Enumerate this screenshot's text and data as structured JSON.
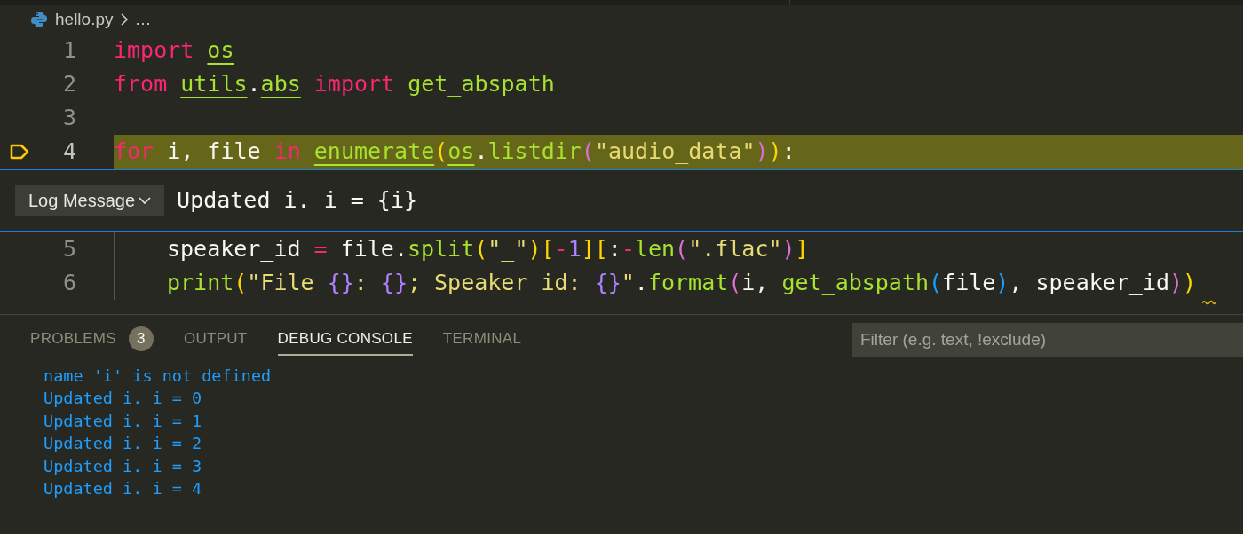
{
  "breadcrumb": {
    "file": "hello.py",
    "more": "…"
  },
  "code_lines": [
    {
      "number": "1",
      "highlighted": false,
      "tokens": [
        {
          "text": "import ",
          "kind": "keyword"
        },
        {
          "text": "os",
          "kind": "module"
        }
      ]
    },
    {
      "number": "2",
      "highlighted": false,
      "tokens": [
        {
          "text": "from ",
          "kind": "keyword"
        },
        {
          "text": "utils",
          "kind": "module"
        },
        {
          "text": ".",
          "kind": "plain"
        },
        {
          "text": "abs",
          "kind": "module"
        },
        {
          "text": " import ",
          "kind": "keyword"
        },
        {
          "text": "get_abspath",
          "kind": "function"
        }
      ]
    },
    {
      "number": "3",
      "highlighted": false
    },
    {
      "number": "4",
      "highlighted": true,
      "tokens": [
        {
          "text": "for",
          "kind": "keyword"
        },
        {
          "text": " i, file ",
          "kind": "plain"
        },
        {
          "text": "in ",
          "kind": "keyword"
        },
        {
          "text": "enumerate",
          "kind": "module"
        },
        {
          "text": "(",
          "kind": "gold"
        },
        {
          "text": "os",
          "kind": "module"
        },
        {
          "text": ".",
          "kind": "plain"
        },
        {
          "text": "listdir",
          "kind": "function"
        },
        {
          "text": "(",
          "kind": "orchid"
        },
        {
          "text": "\"audio_data\"",
          "kind": "string"
        },
        {
          "text": ")",
          "kind": "orchid"
        },
        {
          "text": ")",
          "kind": "gold"
        },
        {
          "text": ":",
          "kind": "plain"
        }
      ]
    }
  ],
  "breakpoint_widget": {
    "type_dropdown": "Log Message",
    "value": "Updated i. i = {i}"
  },
  "loop_body": [
    {
      "number": "5",
      "highlighted": false,
      "tokens": [
        {
          "text": "speaker_id ",
          "kind": "plain"
        },
        {
          "text": "=",
          "kind": "keyword"
        },
        {
          "text": " file.",
          "kind": "plain"
        },
        {
          "text": "split",
          "kind": "function"
        },
        {
          "text": "(",
          "kind": "gold"
        },
        {
          "text": "\"_\"",
          "kind": "string"
        },
        {
          "text": ")",
          "kind": "gold"
        },
        {
          "text": "[",
          "kind": "gold"
        },
        {
          "text": "-",
          "kind": "keyword"
        },
        {
          "text": "1",
          "kind": "number"
        },
        {
          "text": "]",
          "kind": "gold"
        },
        {
          "text": "[",
          "kind": "gold"
        },
        {
          "text": ":",
          "kind": "plain"
        },
        {
          "text": "-",
          "kind": "keyword"
        },
        {
          "text": "len",
          "kind": "function"
        },
        {
          "text": "(",
          "kind": "orchid"
        },
        {
          "text": "\".flac\"",
          "kind": "string"
        },
        {
          "text": ")",
          "kind": "orchid"
        },
        {
          "text": "]",
          "kind": "gold"
        }
      ]
    },
    {
      "number": "6",
      "highlighted": false,
      "tokens": [
        {
          "text": "print",
          "kind": "function"
        },
        {
          "text": "(",
          "kind": "gold"
        },
        {
          "text": "\"File ",
          "kind": "string"
        },
        {
          "text": "{}",
          "kind": "number"
        },
        {
          "text": ": ",
          "kind": "string"
        },
        {
          "text": "{}",
          "kind": "number"
        },
        {
          "text": "; Speaker id: ",
          "kind": "string"
        },
        {
          "text": "{}",
          "kind": "number"
        },
        {
          "text": "\"",
          "kind": "string"
        },
        {
          "text": ".",
          "kind": "plain"
        },
        {
          "text": "format",
          "kind": "function"
        },
        {
          "text": "(",
          "kind": "orchid"
        },
        {
          "text": "i, ",
          "kind": "plain"
        },
        {
          "text": "get_abspath",
          "kind": "function"
        },
        {
          "text": "(",
          "kind": "blue"
        },
        {
          "text": "file",
          "kind": "plain"
        },
        {
          "text": ")",
          "kind": "blue"
        },
        {
          "text": ", speaker_id",
          "kind": "plain"
        },
        {
          "text": ")",
          "kind": "orchid"
        },
        {
          "text": ")",
          "kind": "gold"
        }
      ]
    }
  ],
  "panel": {
    "tabs": [
      {
        "label": "PROBLEMS",
        "selected": false,
        "badge": "3"
      },
      {
        "label": "OUTPUT",
        "selected": false
      },
      {
        "label": "DEBUG CONSOLE",
        "selected": true
      },
      {
        "label": "TERMINAL",
        "selected": false
      }
    ],
    "filter": {
      "placeholder": "Filter (e.g. text, !exclude)"
    },
    "console_lines": [
      "name 'i' is not defined",
      "Updated i. i = 0",
      "Updated i. i = 1",
      "Updated i. i = 2",
      "Updated i. i = 3",
      "Updated i. i = 4"
    ]
  }
}
